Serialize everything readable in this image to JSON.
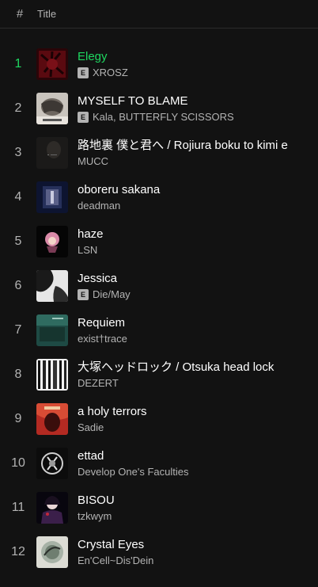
{
  "header": {
    "number_label": "#",
    "title_label": "Title"
  },
  "colors": {
    "background": "#121212",
    "accent": "#1ed760",
    "secondary_text": "#b3b3b3"
  },
  "tracks": [
    {
      "number": "1",
      "title": "Elegy",
      "explicit": true,
      "explicit_label": "E",
      "artists": "XROSZ",
      "playing": true
    },
    {
      "number": "2",
      "title": "MYSELF TO BLAME",
      "explicit": true,
      "explicit_label": "E",
      "artists": "Kala, BUTTERFLY SCISSORS",
      "playing": false
    },
    {
      "number": "3",
      "title": "路地裏 僕と君へ / Rojiura boku to kimi e",
      "explicit": false,
      "explicit_label": "",
      "artists": "MUCC",
      "playing": false
    },
    {
      "number": "4",
      "title": "oboreru sakana",
      "explicit": false,
      "explicit_label": "",
      "artists": "deadman",
      "playing": false
    },
    {
      "number": "5",
      "title": "haze",
      "explicit": false,
      "explicit_label": "",
      "artists": "LSN",
      "playing": false
    },
    {
      "number": "6",
      "title": "Jessica",
      "explicit": true,
      "explicit_label": "E",
      "artists": "Die/May",
      "playing": false
    },
    {
      "number": "7",
      "title": "Requiem",
      "explicit": false,
      "explicit_label": "",
      "artists": "exist†trace",
      "playing": false
    },
    {
      "number": "8",
      "title": "大塚ヘッドロック / Otsuka head lock",
      "explicit": false,
      "explicit_label": "",
      "artists": "DEZERT",
      "playing": false
    },
    {
      "number": "9",
      "title": "a holy terrors",
      "explicit": false,
      "explicit_label": "",
      "artists": "Sadie",
      "playing": false
    },
    {
      "number": "10",
      "title": "ettad",
      "explicit": false,
      "explicit_label": "",
      "artists": "Develop One's Faculties",
      "playing": false
    },
    {
      "number": "11",
      "title": "BISOU",
      "explicit": false,
      "explicit_label": "",
      "artists": "tzkwym",
      "playing": false
    },
    {
      "number": "12",
      "title": "Crystal Eyes",
      "explicit": false,
      "explicit_label": "",
      "artists": "En'Cell~Dis'Dein",
      "playing": false
    }
  ]
}
